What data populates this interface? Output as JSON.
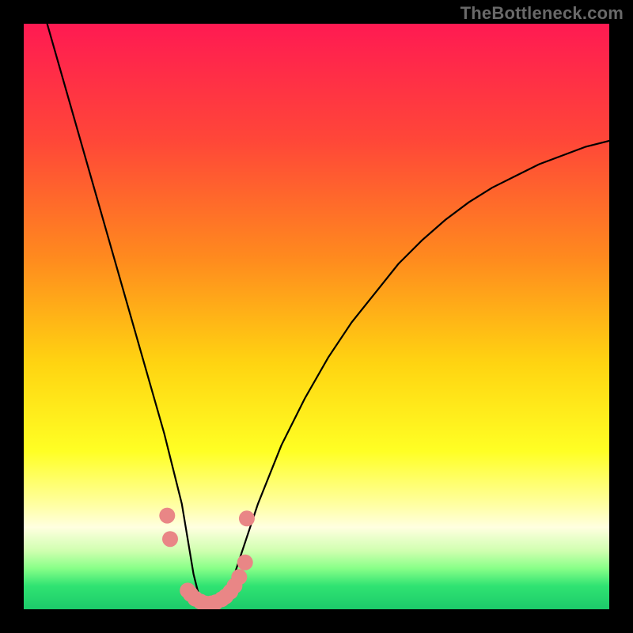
{
  "watermark": "TheBottleneck.com",
  "colors": {
    "frame": "#000000",
    "gradient_stops": [
      {
        "offset": 0.0,
        "color": "#ff1a52"
      },
      {
        "offset": 0.2,
        "color": "#ff4738"
      },
      {
        "offset": 0.4,
        "color": "#ff8a1e"
      },
      {
        "offset": 0.58,
        "color": "#ffd411"
      },
      {
        "offset": 0.73,
        "color": "#ffff24"
      },
      {
        "offset": 0.82,
        "color": "#ffffa0"
      },
      {
        "offset": 0.86,
        "color": "#ffffe0"
      },
      {
        "offset": 0.9,
        "color": "#d0ffb0"
      },
      {
        "offset": 0.93,
        "color": "#88ff88"
      },
      {
        "offset": 0.96,
        "color": "#30e372"
      },
      {
        "offset": 1.0,
        "color": "#1ccb6a"
      }
    ],
    "curve": "#000000",
    "markers": "#e98686"
  },
  "chart_data": {
    "type": "line",
    "title": "",
    "xlabel": "",
    "ylabel": "",
    "xlim": [
      0,
      100
    ],
    "ylim": [
      0,
      100
    ],
    "grid": false,
    "legend": false,
    "series": [
      {
        "name": "bottleneck-curve",
        "x": [
          4,
          6,
          8,
          10,
          12,
          14,
          16,
          18,
          20,
          22,
          24,
          26,
          27,
          28,
          29,
          30,
          31,
          32,
          34,
          36,
          38,
          40,
          44,
          48,
          52,
          56,
          60,
          64,
          68,
          72,
          76,
          80,
          84,
          88,
          92,
          96,
          100
        ],
        "y": [
          100,
          93,
          86,
          79,
          72,
          65,
          58,
          51,
          44,
          37,
          30,
          22,
          18,
          12,
          6,
          2,
          0,
          0,
          2,
          6,
          12,
          18,
          28,
          36,
          43,
          49,
          54,
          59,
          63,
          66.5,
          69.5,
          72,
          74,
          76,
          77.5,
          79,
          80
        ]
      }
    ],
    "markers": [
      {
        "x": 24.5,
        "y": 16
      },
      {
        "x": 25.0,
        "y": 12
      },
      {
        "x": 28.0,
        "y": 3.2
      },
      {
        "x": 28.5,
        "y": 2.6
      },
      {
        "x": 29.3,
        "y": 1.8
      },
      {
        "x": 30.2,
        "y": 1.3
      },
      {
        "x": 31.0,
        "y": 1.0
      },
      {
        "x": 32.0,
        "y": 1.0
      },
      {
        "x": 32.8,
        "y": 1.2
      },
      {
        "x": 33.8,
        "y": 1.7
      },
      {
        "x": 34.5,
        "y": 2.2
      },
      {
        "x": 35.3,
        "y": 3.0
      },
      {
        "x": 36.0,
        "y": 4.0
      },
      {
        "x": 36.8,
        "y": 5.5
      },
      {
        "x": 37.8,
        "y": 8.0
      },
      {
        "x": 38.1,
        "y": 15.5
      }
    ],
    "marker_radius_px": 10
  }
}
